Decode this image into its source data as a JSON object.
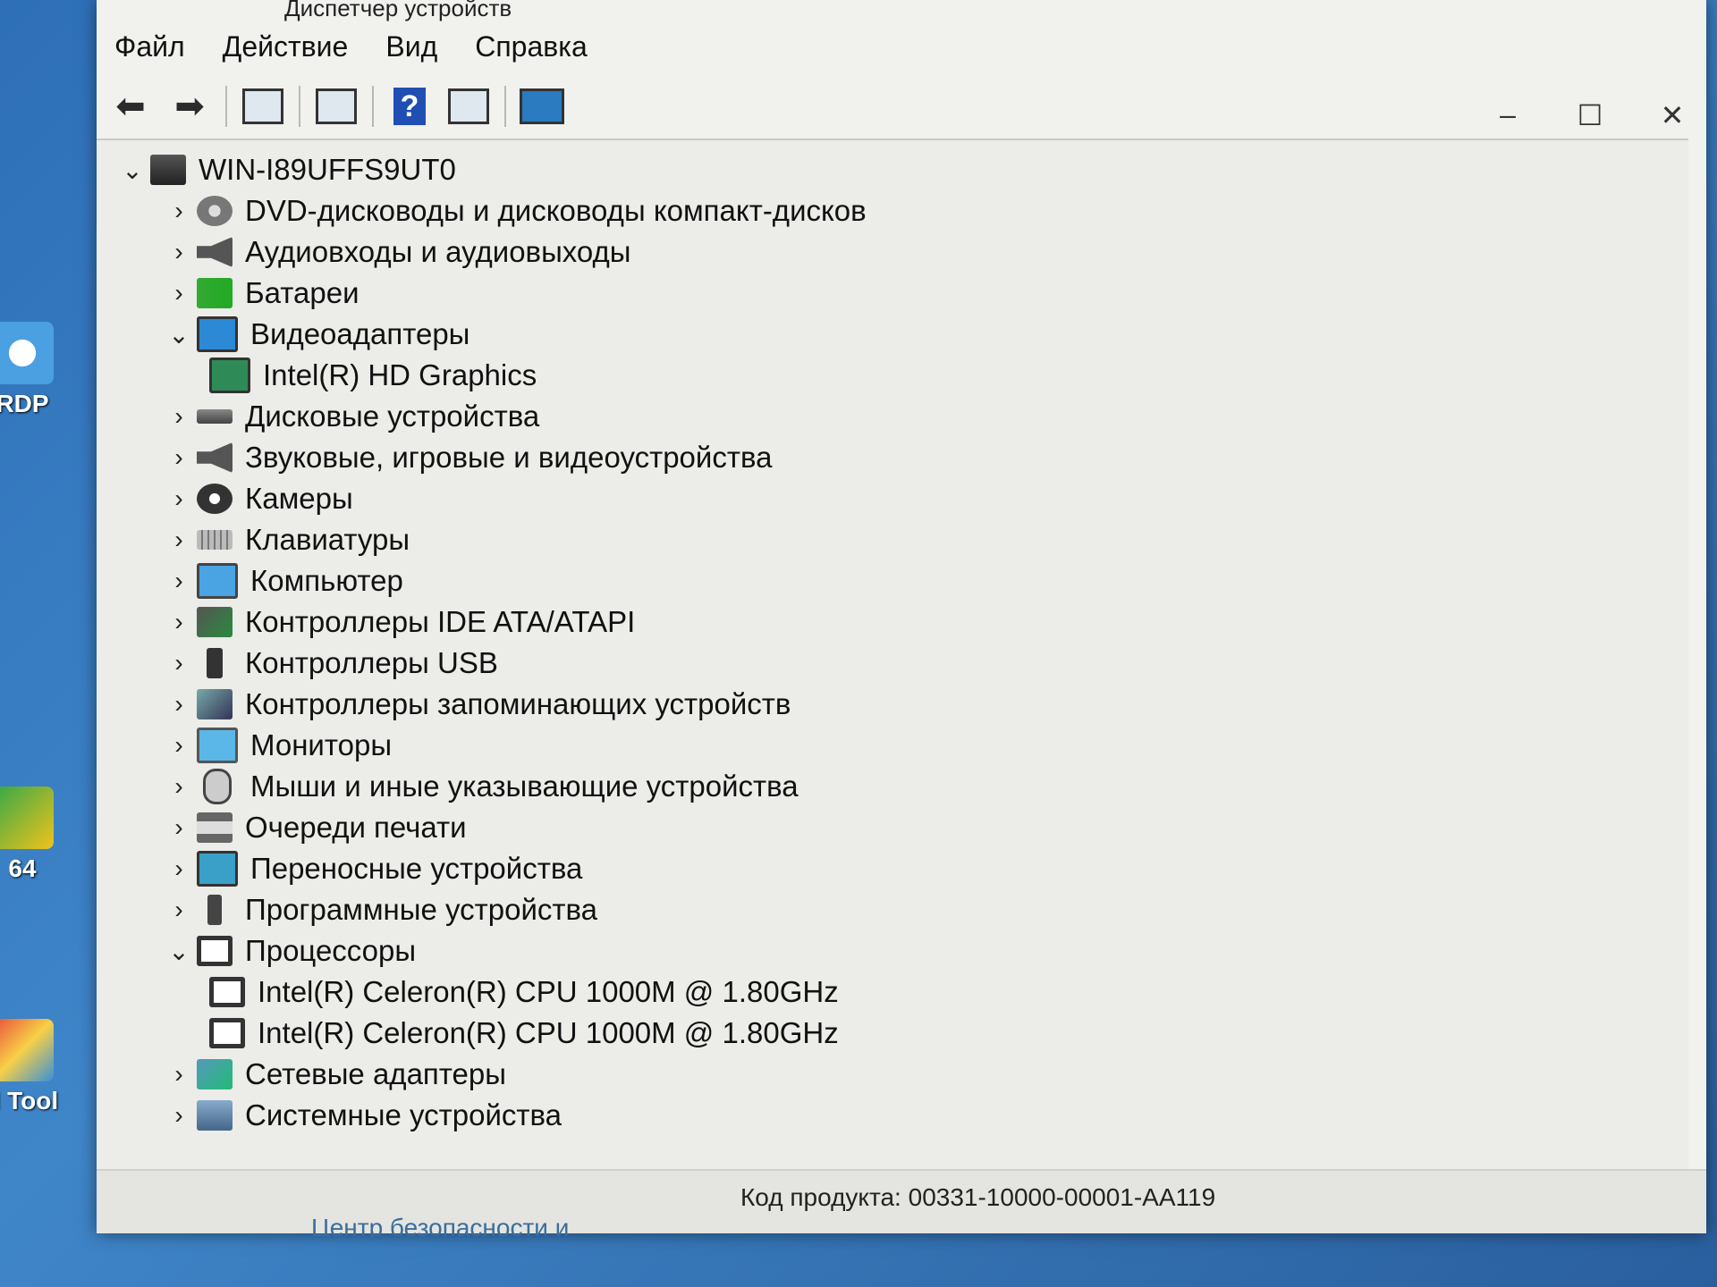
{
  "window": {
    "title": "Диспетчер устройств"
  },
  "menu": [
    "Файл",
    "Действие",
    "Вид",
    "Справка"
  ],
  "toolbar": {
    "buttons": [
      "back-icon",
      "forward-icon",
      "properties-icon",
      "update-driver-icon",
      "help-icon",
      "details-icon",
      "scan-hardware-icon"
    ]
  },
  "window_controls": {
    "minimize": "–",
    "maximize": "☐",
    "close": "✕"
  },
  "tree": {
    "root": "WIN-I89UFFS9UT0",
    "categories": [
      {
        "label": "DVD-дисководы и дисководы компакт-дисков",
        "icon": "dvd-icon",
        "expanded": false
      },
      {
        "label": "Аудиовходы и аудиовыходы",
        "icon": "audio-icon",
        "expanded": false
      },
      {
        "label": "Батареи",
        "icon": "battery-icon",
        "expanded": false
      },
      {
        "label": "Видеоадаптеры",
        "icon": "display-adapter-icon",
        "expanded": true,
        "children": [
          "Intel(R) HD Graphics"
        ]
      },
      {
        "label": "Дисковые устройства",
        "icon": "disk-icon",
        "expanded": false
      },
      {
        "label": "Звуковые, игровые и видеоустройства",
        "icon": "sound-icon",
        "expanded": false
      },
      {
        "label": "Камеры",
        "icon": "camera-icon",
        "expanded": false
      },
      {
        "label": "Клавиатуры",
        "icon": "keyboard-icon",
        "expanded": false
      },
      {
        "label": "Компьютер",
        "icon": "computer-icon",
        "expanded": false
      },
      {
        "label": "Контроллеры IDE ATA/ATAPI",
        "icon": "ide-controller-icon",
        "expanded": false
      },
      {
        "label": "Контроллеры USB",
        "icon": "usb-icon",
        "expanded": false
      },
      {
        "label": "Контроллеры запоминающих устройств",
        "icon": "storage-controller-icon",
        "expanded": false
      },
      {
        "label": "Мониторы",
        "icon": "monitor-icon",
        "expanded": false
      },
      {
        "label": "Мыши и иные указывающие устройства",
        "icon": "mouse-icon",
        "expanded": false
      },
      {
        "label": "Очереди печати",
        "icon": "printer-icon",
        "expanded": false
      },
      {
        "label": "Переносные устройства",
        "icon": "portable-device-icon",
        "expanded": false
      },
      {
        "label": "Программные устройства",
        "icon": "software-device-icon",
        "expanded": false
      },
      {
        "label": "Процессоры",
        "icon": "processor-icon",
        "expanded": true,
        "children": [
          "Intel(R) Celeron(R) CPU 1000M @ 1.80GHz",
          "Intel(R) Celeron(R) CPU 1000M @ 1.80GHz"
        ]
      },
      {
        "label": "Сетевые адаптеры",
        "icon": "network-adapter-icon",
        "expanded": false
      },
      {
        "label": "Системные устройства",
        "icon": "system-device-icon",
        "expanded": false
      }
    ]
  },
  "background": {
    "product_code": "Код продукта:  00331-10000-00001-AA119",
    "security_center": "Центр безопасности и"
  },
  "desktop": {
    "icons": [
      "RDP",
      "64",
      "ll Tool"
    ]
  }
}
